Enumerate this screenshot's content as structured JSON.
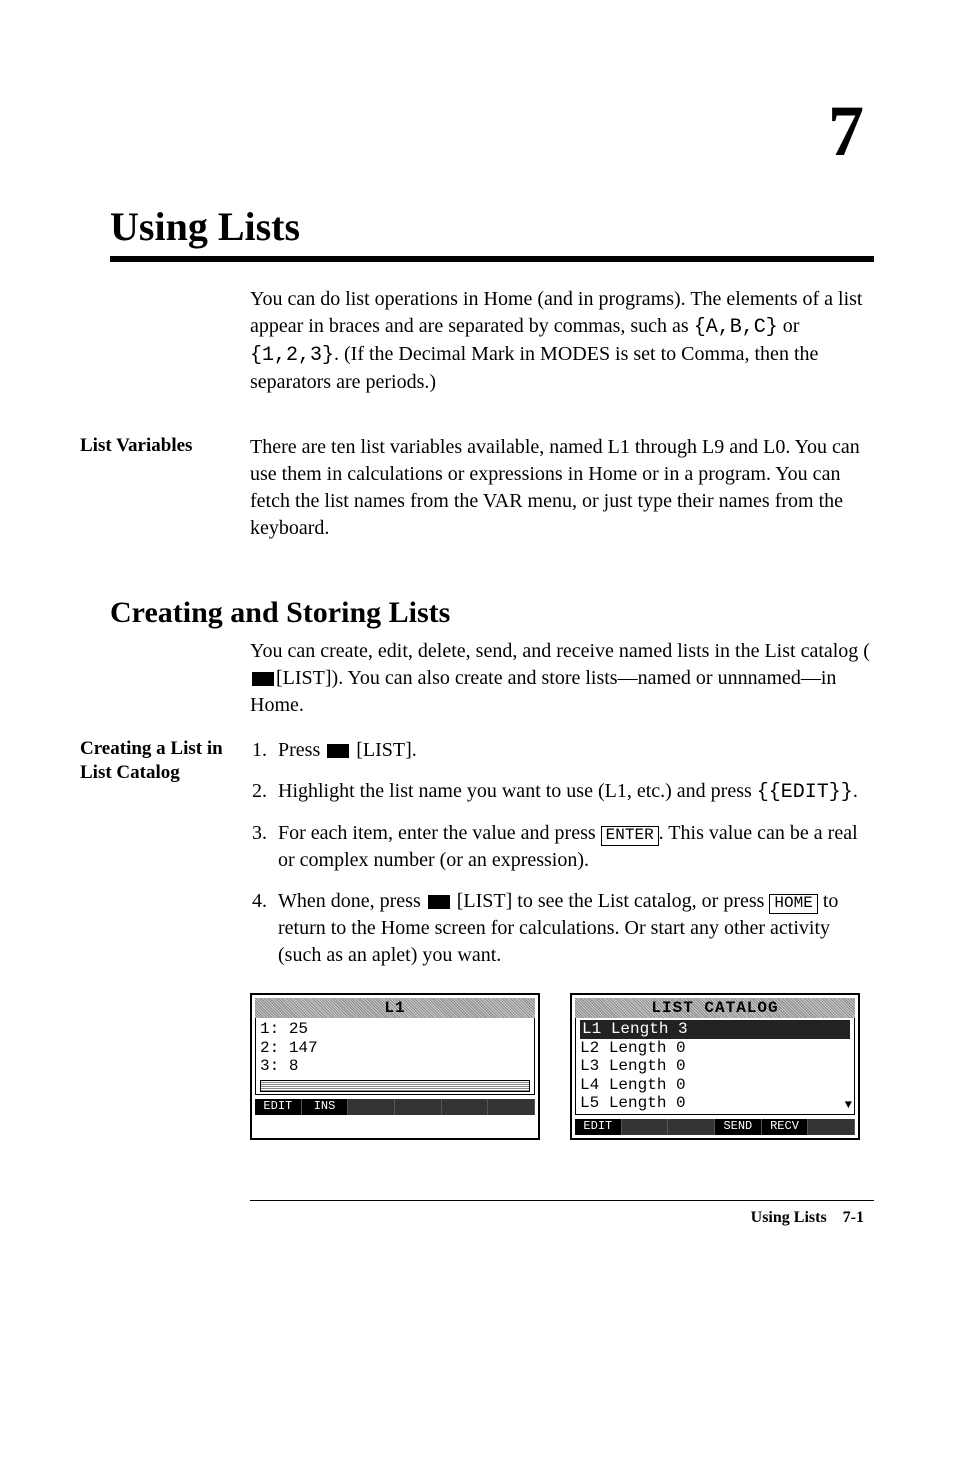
{
  "chapter_number": "7",
  "title": "Using Lists",
  "intro_paragraph_parts": {
    "p1a": "You can do list operations in Home (and in programs). The elements of a list appear in braces and are separated by commas, such as ",
    "code1": "{A,B,C}",
    "p1b": " or ",
    "code2": "{1,2,3}",
    "p1c": ". (If the Decimal Mark in MODES is set to Comma, then the separators are periods.)"
  },
  "list_variables": {
    "heading": "List Variables",
    "text": "There are ten list variables available, named L1 through L9 and L0. You can use them in calculations or expressions in Home or in a program. You can fetch the list names from the VAR menu, or just type their names from the keyboard."
  },
  "subtitle": "Creating and Storing Lists",
  "creating_intro": {
    "a": "You can create, edit, delete, send, and receive named lists in the List catalog (",
    "list_label": "[LIST]",
    "b": "). You can also create and store lists—named or unnnamed—in Home."
  },
  "creating_list": {
    "heading": "Creating a List in List Catalog",
    "steps": {
      "s1a": "Press ",
      "s1b": " [LIST].",
      "s2a": "Highlight the list name you want to use (L1, etc.) and press ",
      "s2code": "{{EDIT}}",
      "s2b": ".",
      "s3a": "For each item, enter the value and press ",
      "s3key": "ENTER",
      "s3b": ". This value can be a real or complex number (or an expression).",
      "s4a": "When done, press ",
      "s4b": " [LIST] to see the List catalog, or press ",
      "s4key": "HOME",
      "s4c": " to return to the Home screen for calculations. Or start any other activity (such as an aplet) you want."
    }
  },
  "screen_left": {
    "title": "L1",
    "rows": [
      {
        "idx": "1:",
        "val": "25"
      },
      {
        "idx": "2:",
        "val": "147"
      },
      {
        "idx": "3:",
        "val": "8"
      }
    ],
    "softkeys": [
      "EDIT",
      "INS",
      "",
      "",
      "",
      ""
    ]
  },
  "screen_right": {
    "title": "LIST CATALOG",
    "rows": [
      {
        "name": "L1",
        "len": "Length 3",
        "sel": true
      },
      {
        "name": "L2",
        "len": "Length 0",
        "sel": false
      },
      {
        "name": "L3",
        "len": "Length 0",
        "sel": false
      },
      {
        "name": "L4",
        "len": "Length 0",
        "sel": false
      },
      {
        "name": "L5",
        "len": "Length 0",
        "sel": false
      }
    ],
    "softkeys": [
      "EDIT",
      "",
      "",
      "SEND",
      "RECV",
      ""
    ]
  },
  "footer": {
    "label": "Using Lists",
    "page": "7-1"
  }
}
